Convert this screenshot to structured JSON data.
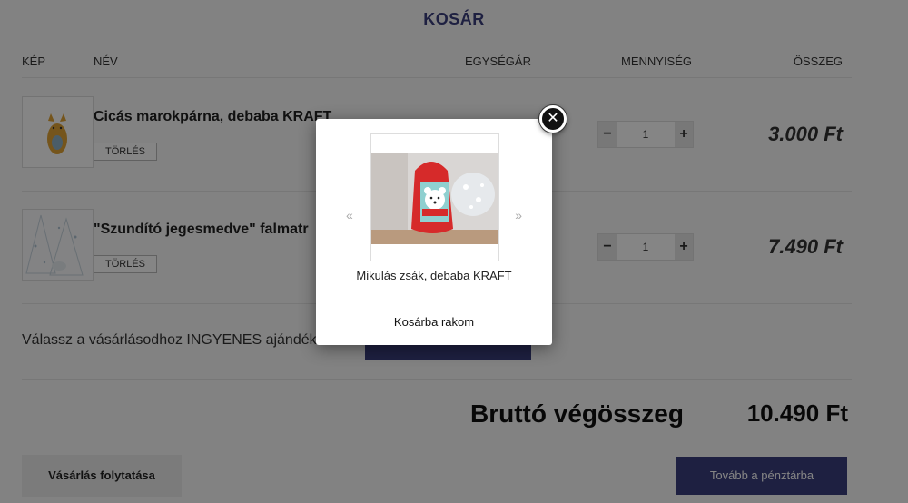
{
  "cart": {
    "title": "KOSÁR",
    "columns": {
      "image": "KÉP",
      "name": "NÉV",
      "unit_price": "EGYSÉGÁR",
      "quantity": "MENNYISÉG",
      "total": "ÖSSZEG"
    },
    "items": [
      {
        "name": "Cicás marokpárna, debaba KRAFT",
        "delete_label": "TÖRLÉS",
        "quantity": "1",
        "minus": "−",
        "plus": "+",
        "price": "3.000 Ft"
      },
      {
        "name": "\"Szundító jegesmedve\" falmatr",
        "delete_label": "TÖRLÉS",
        "quantity": "1",
        "minus": "−",
        "plus": "+",
        "price": "7.490 Ft"
      }
    ],
    "gift_text": "Válassz a vásárlásodhoz INGYENES ajándék",
    "total_label": "Bruttó végösszeg",
    "total_value": "10.490 Ft",
    "continue_label": "Vásárlás folytatása",
    "checkout_label": "Tovább a pénztárba"
  },
  "modal": {
    "close_symbol": "✕",
    "prev_symbol": "«",
    "next_symbol": "»",
    "product_name": "Mikulás zsák, debaba KRAFT",
    "add_to_cart": "Kosárba rakom"
  },
  "colors": {
    "accent": "#3b3f7d",
    "overlay": "rgba(0,0,0,0.48)"
  }
}
